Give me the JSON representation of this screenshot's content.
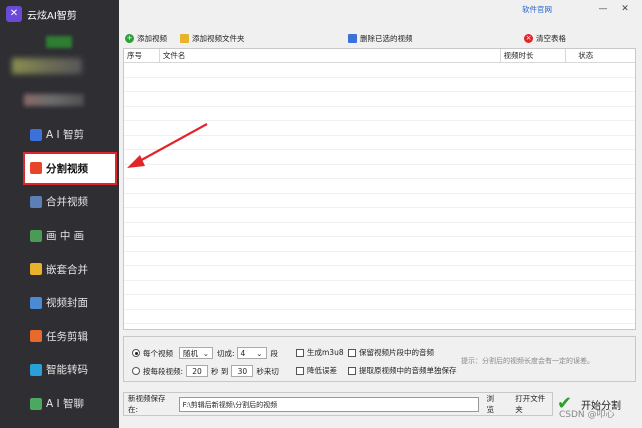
{
  "app": {
    "title": "云炫AI智剪",
    "logo_glyph": "✕"
  },
  "sidebar": {
    "items": [
      {
        "label": "A I 智剪",
        "icon": "ai-cut-icon",
        "color": "#3a72d9"
      },
      {
        "label": "分割视频",
        "icon": "split-video-icon",
        "color": "#e8442a",
        "active": true
      },
      {
        "label": "合并视频",
        "icon": "merge-video-icon",
        "color": "#5d7fb8"
      },
      {
        "label": "画 中 画",
        "icon": "picture-in-picture-icon",
        "color": "#4a9b55"
      },
      {
        "label": "嵌套合并",
        "icon": "nest-merge-icon",
        "color": "#e8b32a"
      },
      {
        "label": "视频封面",
        "icon": "video-cover-icon",
        "color": "#4a8ad6"
      },
      {
        "label": "任务剪辑",
        "icon": "task-edit-icon",
        "color": "#e86a2a"
      },
      {
        "label": "智能转码",
        "icon": "smart-transcode-icon",
        "color": "#2aa0d9"
      },
      {
        "label": "A I 智聊",
        "icon": "ai-chat-icon",
        "color": "#4aa860"
      }
    ]
  },
  "topbar": {
    "link": "软件官网",
    "minimize": "—",
    "close": "✕"
  },
  "toolbar": {
    "add_video": "添加视频",
    "add_folder": "添加视频文件夹",
    "delete_selected": "删除已选的视频",
    "clear_table": "清空表格"
  },
  "table": {
    "columns": [
      "序号",
      "文件名",
      "视频时长",
      "状态"
    ]
  },
  "options": {
    "per_video": "每个视频",
    "mode_value": "随机",
    "cut_label": "切成:",
    "cut_value": "4",
    "segment_unit": "段",
    "by_seconds": "按每段视频:",
    "sec_from": "20",
    "sec_unit": "秒 到",
    "sec_to": "30",
    "sec_cut": "秒来切",
    "gen_m3u8": "生成m3u8",
    "reduce_dup": "降低误差",
    "keep_audio": "保留视频片段中的音频",
    "extract_audio": "提取原视频中的音频单独保存",
    "hint": "提示：分割后的视频长度会有一定的误差。"
  },
  "save": {
    "label": "新视频保存在:",
    "path": "F:\\剪辑后新视频\\分割后的视频",
    "browse": "浏览",
    "open_folder": "打开文件夹"
  },
  "start": {
    "label": "开始分割",
    "check": "✔"
  },
  "watermark": "CSDN @叩心"
}
